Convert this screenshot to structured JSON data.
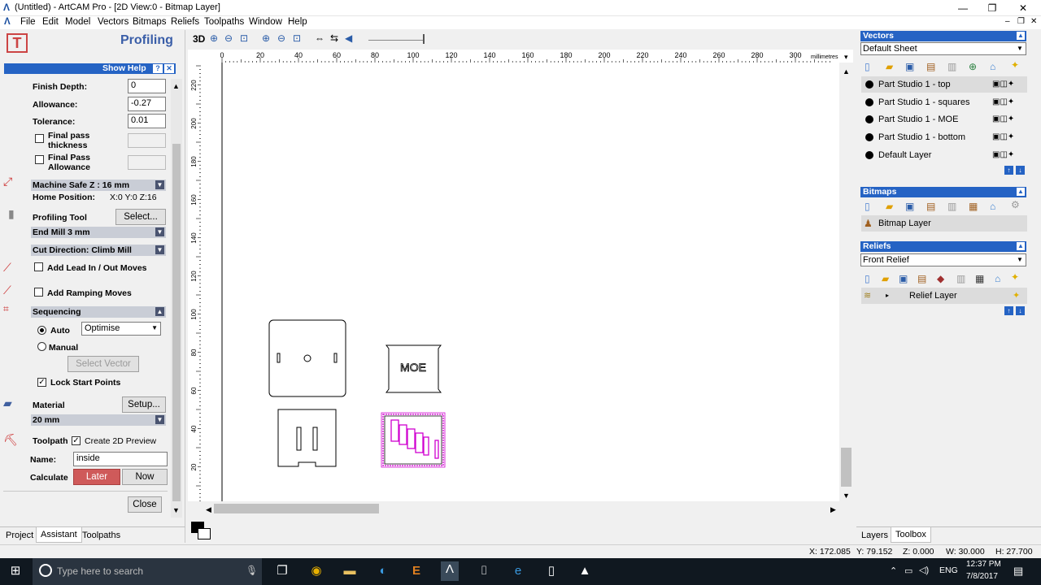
{
  "title": "(Untitled) - ArtCAM Pro - [2D View:0 - Bitmap Layer]",
  "menu": [
    "File",
    "Edit",
    "Model",
    "Vectors",
    "Bitmaps",
    "Reliefs",
    "Toolpaths",
    "Window",
    "Help"
  ],
  "panel": {
    "title": "Profiling",
    "show_help": "Show Help",
    "finish_depth_label": "Finish Depth:",
    "finish_depth": "0",
    "allowance_label": "Allowance:",
    "allowance": "-0.27",
    "tolerance_label": "Tolerance:",
    "tolerance": "0.01",
    "final_pass_thickness_1": "Final pass",
    "final_pass_thickness_2": "thickness",
    "final_pass_allowance_1": "Final Pass",
    "final_pass_allowance_2": "Allowance",
    "machine_safe_z": "Machine Safe Z : 16 mm",
    "home_position_label": "Home Position:",
    "home_position": "X:0 Y:0 Z:16",
    "profiling_tool_label": "Profiling Tool",
    "select_button": "Select...",
    "tool": "End Mill 3 mm",
    "cut_direction": "Cut Direction: Climb Mill",
    "lead_in": "Add Lead In / Out Moves",
    "ramping": "Add Ramping Moves",
    "sequencing": "Sequencing",
    "auto": "Auto",
    "optimise": "Optimise",
    "manual": "Manual",
    "select_vector": "Select Vector",
    "lock_start": "Lock Start Points",
    "material_label": "Material",
    "setup_button": "Setup...",
    "material": "20 mm",
    "toolpath_label": "Toolpath",
    "create_preview": "Create 2D Preview",
    "name_label": "Name:",
    "name_value": "inside",
    "calculate_label": "Calculate",
    "later": "Later",
    "now": "Now",
    "close": "Close"
  },
  "bottom_tabs": [
    "Project",
    "Assistant",
    "Toolpaths"
  ],
  "right_tabs": [
    "Layers",
    "Toolbox"
  ],
  "canvas": {
    "x_ticks": [
      "0",
      "20",
      "40",
      "60",
      "80",
      "100",
      "120",
      "140",
      "160",
      "180",
      "200",
      "220",
      "240",
      "260",
      "280",
      "300"
    ],
    "units": "millimetres",
    "y_ticks": [
      "220",
      "200",
      "180",
      "160",
      "140",
      "120",
      "100",
      "80",
      "60",
      "40",
      "20"
    ],
    "moe_text": "MOE"
  },
  "vectors": {
    "header": "Vectors",
    "sheet": "Default Sheet",
    "layers": [
      "Part Studio 1 - top",
      "Part Studio 1 - squares",
      "Part Studio 1 - MOE",
      "Part Studio 1 - bottom",
      "Default Layer"
    ]
  },
  "bitmaps": {
    "header": "Bitmaps",
    "layer": "Bitmap Layer"
  },
  "reliefs": {
    "header": "Reliefs",
    "relief": "Front Relief",
    "layer": "Relief Layer"
  },
  "status": {
    "x": "X: 172.085",
    "y": "Y: 79.152",
    "z": "Z: 0.000",
    "w": "W: 30.000",
    "h": "H: 27.700"
  },
  "taskbar": {
    "search": "Type here to search",
    "lang": "ENG",
    "time": "12:37 PM",
    "date": "7/8/2017"
  },
  "colors": {
    "accent": "#2563c4",
    "later_button": "#cf5a5a",
    "toolpath": "#d000d0"
  }
}
